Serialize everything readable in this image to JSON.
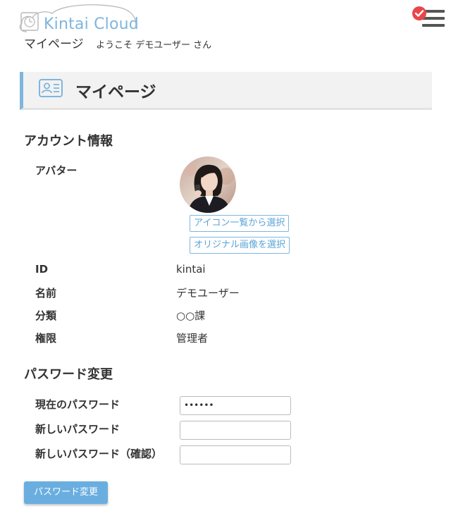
{
  "header": {
    "logo_text": "Kintai Cloud",
    "menu_icon": "hamburger-menu-icon",
    "badge_icon": "check-badge-icon",
    "badge_color": "#e8474a"
  },
  "subheader": {
    "page_name": "マイページ",
    "welcome": "ようこそ デモユーザー さん"
  },
  "page_title": {
    "icon": "id-card-icon",
    "text": "マイページ"
  },
  "account": {
    "section_title": "アカウント情報",
    "avatar_label": "アバター",
    "select_icon_button": "アイコン一覧から選択",
    "select_image_button": "オリジナル画像を選択",
    "fields": [
      {
        "label": "ID",
        "value": "kintai"
      },
      {
        "label": "名前",
        "value": "デモユーザー"
      },
      {
        "label": "分類",
        "value": "○○課"
      },
      {
        "label": "権限",
        "value": "管理者"
      }
    ]
  },
  "password": {
    "section_title": "パスワード変更",
    "fields": [
      {
        "label": "現在のパスワード",
        "value": "••••••"
      },
      {
        "label": "新しいパスワード",
        "value": ""
      },
      {
        "label": "新しいパスワード（確認）",
        "value": ""
      }
    ],
    "submit_label": "パスワード変更"
  },
  "colors": {
    "accent": "#7fb6dd",
    "button": "#6aaee0"
  }
}
